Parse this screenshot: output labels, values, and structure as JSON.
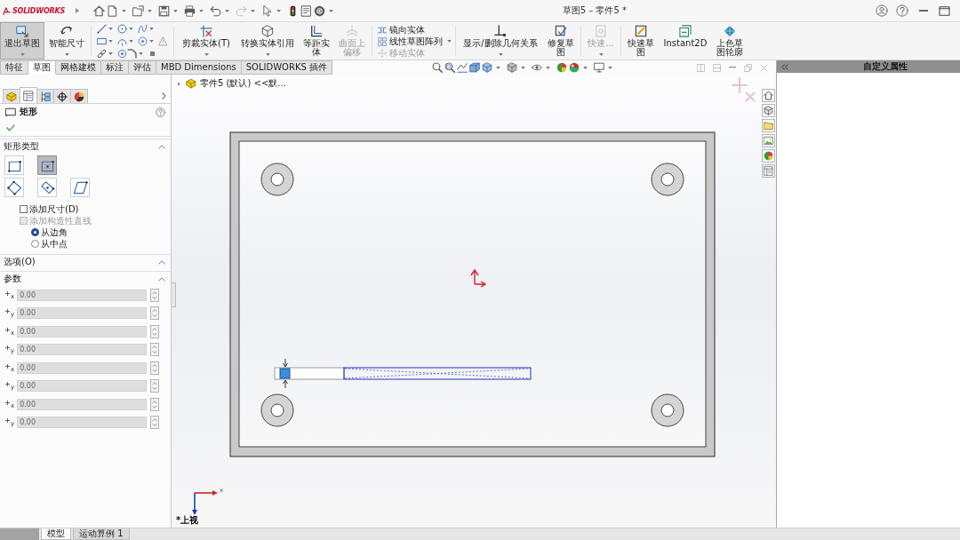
{
  "title_bar": {
    "logo": "SOLIDWORKS",
    "title": "草图5 – 零件5 *"
  },
  "ribbon": {
    "groups": [
      {
        "kind": "large",
        "items": [
          {
            "label": "退出草图",
            "selected": true,
            "disabled": false,
            "menu": true
          },
          {
            "label": "智能尺寸",
            "selected": false,
            "disabled": false,
            "menu": true
          }
        ]
      },
      {
        "kind": "tools"
      },
      {
        "kind": "large",
        "items": [
          {
            "label": "剪裁实体(T)",
            "selected": false,
            "disabled": false,
            "menu": true
          },
          {
            "label": "转换实体引用",
            "selected": false,
            "disabled": false,
            "menu": true
          },
          {
            "label": "等距实体",
            "selected": false,
            "disabled": false,
            "menu": false
          },
          {
            "label": "曲面上偏移",
            "selected": false,
            "disabled": true,
            "menu": false
          }
        ]
      },
      {
        "kind": "stack",
        "menu": true,
        "items": [
          {
            "label": "镜向实体",
            "disabled": false
          },
          {
            "label": "线性草图阵列",
            "disabled": false
          },
          {
            "label": "移动实体",
            "disabled": true
          }
        ]
      },
      {
        "kind": "large",
        "items": [
          {
            "label": "显示/删除几何关系",
            "selected": false,
            "disabled": false,
            "menu": true
          },
          {
            "label": "修复草图",
            "selected": false,
            "disabled": false,
            "menu": false
          }
        ]
      },
      {
        "kind": "large",
        "items": [
          {
            "label": "快速...",
            "selected": false,
            "disabled": true,
            "menu": true
          }
        ]
      },
      {
        "kind": "large",
        "items": [
          {
            "label": "快速草图",
            "selected": false,
            "disabled": false,
            "menu": false
          },
          {
            "label": "Instant2D",
            "selected": false,
            "disabled": false,
            "menu": false
          },
          {
            "label": "上色草图轮廓",
            "selected": false,
            "disabled": false,
            "menu": false
          }
        ]
      }
    ]
  },
  "command_tabs": [
    {
      "label": "特征",
      "selected": false
    },
    {
      "label": "草图",
      "selected": true
    },
    {
      "label": "网格建模",
      "selected": false
    },
    {
      "label": "标注",
      "selected": false
    },
    {
      "label": "评估",
      "selected": false
    },
    {
      "label": "MBD Dimensions",
      "selected": false
    },
    {
      "label": "SOLIDWORKS 插件",
      "selected": false
    }
  ],
  "property_manager": {
    "tabs": [
      {
        "selected": false
      },
      {
        "selected": true
      },
      {
        "selected": false
      },
      {
        "selected": false
      },
      {
        "selected": false
      }
    ],
    "title": "矩形",
    "sections": [
      {
        "kind": "rect-type",
        "title": "矩形类型",
        "expanded": true,
        "types": [
          {
            "selected": false
          },
          {
            "selected": true
          },
          {
            "selected": false
          },
          {
            "selected": false
          },
          {
            "selected": false
          }
        ],
        "checks": [
          {
            "label": "添加尺寸(D)",
            "checked": false,
            "disabled": false
          },
          {
            "label": "添加构造性直线",
            "checked": false,
            "disabled": true
          }
        ],
        "radios": [
          {
            "label": "从边角",
            "selected": true
          },
          {
            "label": "从中点",
            "selected": false
          }
        ]
      },
      {
        "kind": "options",
        "title": "选项(O)",
        "expanded": true
      },
      {
        "kind": "parameters",
        "title": "参数",
        "expanded": true,
        "fields": [
          {
            "axis": "x",
            "value": "0.00",
            "disabled": true
          },
          {
            "axis": "y",
            "value": "0.00",
            "disabled": true
          },
          {
            "axis": "x",
            "value": "0.00",
            "disabled": true
          },
          {
            "axis": "y",
            "value": "0.00",
            "disabled": true
          },
          {
            "axis": "x",
            "value": "0.00",
            "disabled": true
          },
          {
            "axis": "y",
            "value": "0.00",
            "disabled": true
          },
          {
            "axis": "x",
            "value": "0.00",
            "disabled": true
          },
          {
            "axis": "y",
            "value": "0.00",
            "disabled": true
          }
        ]
      }
    ]
  },
  "canvas": {
    "tree_path": "零件5 (默认) <<默...",
    "axis_label": "x",
    "view_name": "*上视"
  },
  "task_pane": {
    "title": "自定义属性"
  },
  "bottom_tabs": [
    {
      "label": "模型",
      "selected": true
    },
    {
      "label": "运动算例 1",
      "selected": false
    }
  ]
}
